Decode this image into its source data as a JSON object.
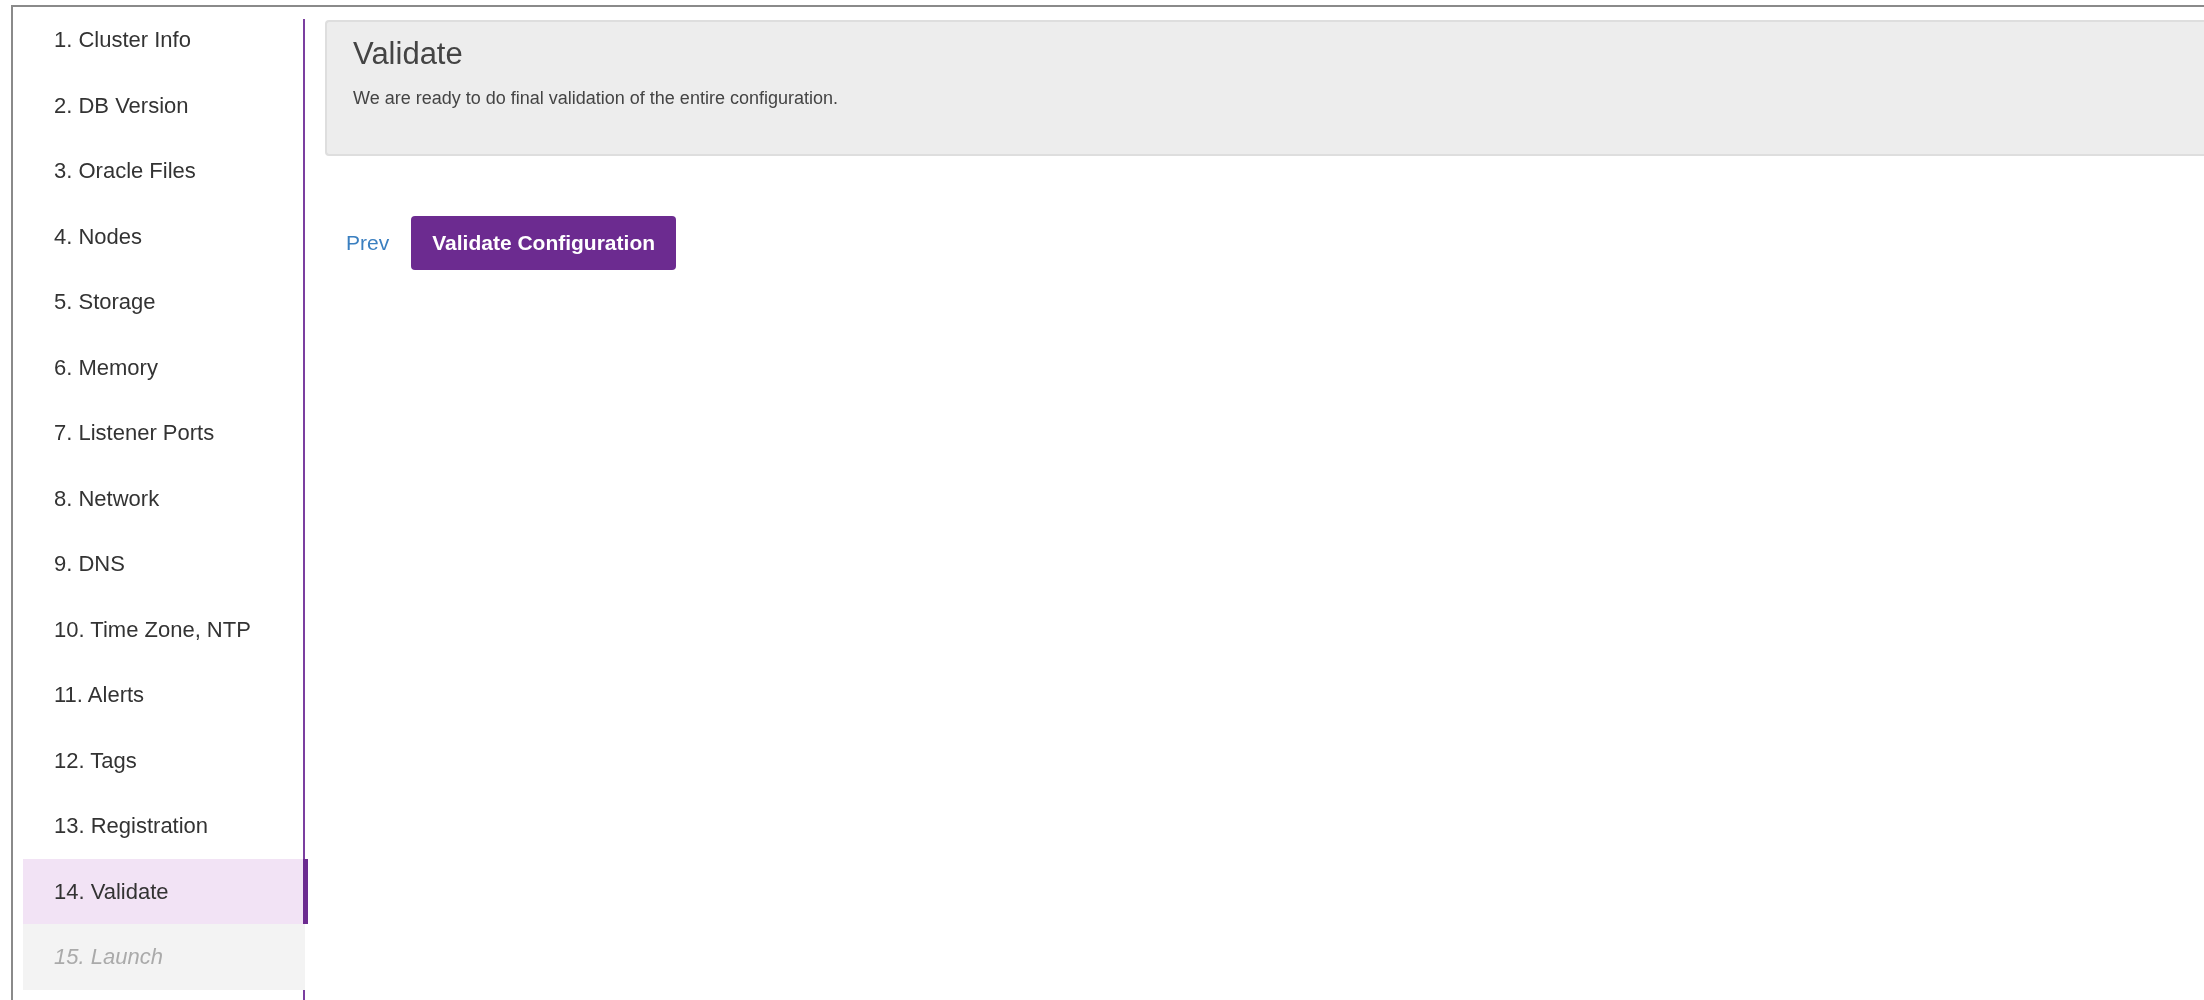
{
  "sidebar": {
    "items": [
      {
        "label": "1. Cluster Info",
        "selected": false,
        "disabled": false
      },
      {
        "label": "2. DB Version",
        "selected": false,
        "disabled": false
      },
      {
        "label": "3. Oracle Files",
        "selected": false,
        "disabled": false
      },
      {
        "label": "4. Nodes",
        "selected": false,
        "disabled": false
      },
      {
        "label": "5. Storage",
        "selected": false,
        "disabled": false
      },
      {
        "label": "6. Memory",
        "selected": false,
        "disabled": false
      },
      {
        "label": "7. Listener Ports",
        "selected": false,
        "disabled": false
      },
      {
        "label": "8. Network",
        "selected": false,
        "disabled": false
      },
      {
        "label": "9. DNS",
        "selected": false,
        "disabled": false
      },
      {
        "label": "10. Time Zone, NTP",
        "selected": false,
        "disabled": false
      },
      {
        "label": "11. Alerts",
        "selected": false,
        "disabled": false
      },
      {
        "label": "12. Tags",
        "selected": false,
        "disabled": false
      },
      {
        "label": "13. Registration",
        "selected": false,
        "disabled": false
      },
      {
        "label": "14. Validate",
        "selected": true,
        "disabled": false
      },
      {
        "label": "15. Launch",
        "selected": false,
        "disabled": true
      }
    ]
  },
  "header": {
    "title": "Validate",
    "description": "We are ready to do final validation of the entire configuration."
  },
  "actions": {
    "prev": "Prev",
    "primary": "Validate Configuration"
  }
}
